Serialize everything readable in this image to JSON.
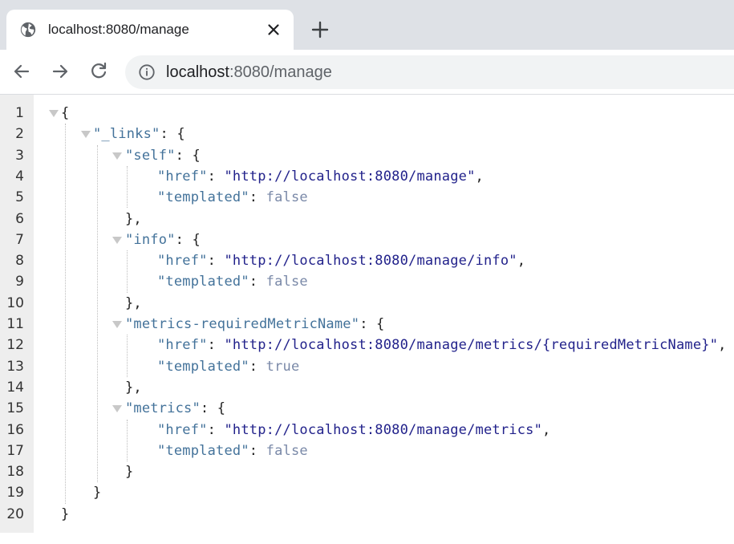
{
  "browser": {
    "tab": {
      "title": "localhost:8080/manage"
    },
    "address": {
      "host": "localhost",
      "rest": ":8080/manage"
    }
  },
  "json_view": {
    "line_numbers": [
      "1",
      "2",
      "3",
      "4",
      "5",
      "6",
      "7",
      "8",
      "9",
      "10",
      "11",
      "12",
      "13",
      "14",
      "15",
      "16",
      "17",
      "18",
      "19",
      "20"
    ],
    "lines": [
      {
        "indent": 0,
        "collapsible": true,
        "parts": [
          [
            "punct",
            "{"
          ]
        ]
      },
      {
        "indent": 1,
        "collapsible": true,
        "parts": [
          [
            "key",
            "\"_links\""
          ],
          [
            "punct",
            ": {"
          ]
        ]
      },
      {
        "indent": 2,
        "collapsible": true,
        "parts": [
          [
            "key",
            "\"self\""
          ],
          [
            "punct",
            ": {"
          ]
        ]
      },
      {
        "indent": 3,
        "collapsible": false,
        "parts": [
          [
            "key",
            "\"href\""
          ],
          [
            "punct",
            ": "
          ],
          [
            "str",
            "\"http://localhost:8080/manage\""
          ],
          [
            "punct",
            ","
          ]
        ]
      },
      {
        "indent": 3,
        "collapsible": false,
        "parts": [
          [
            "key",
            "\"templated\""
          ],
          [
            "punct",
            ": "
          ],
          [
            "bool",
            "false"
          ]
        ]
      },
      {
        "indent": 2,
        "collapsible": false,
        "parts": [
          [
            "punct",
            "},"
          ]
        ]
      },
      {
        "indent": 2,
        "collapsible": true,
        "parts": [
          [
            "key",
            "\"info\""
          ],
          [
            "punct",
            ": {"
          ]
        ]
      },
      {
        "indent": 3,
        "collapsible": false,
        "parts": [
          [
            "key",
            "\"href\""
          ],
          [
            "punct",
            ": "
          ],
          [
            "str",
            "\"http://localhost:8080/manage/info\""
          ],
          [
            "punct",
            ","
          ]
        ]
      },
      {
        "indent": 3,
        "collapsible": false,
        "parts": [
          [
            "key",
            "\"templated\""
          ],
          [
            "punct",
            ": "
          ],
          [
            "bool",
            "false"
          ]
        ]
      },
      {
        "indent": 2,
        "collapsible": false,
        "parts": [
          [
            "punct",
            "},"
          ]
        ]
      },
      {
        "indent": 2,
        "collapsible": true,
        "parts": [
          [
            "key",
            "\"metrics-requiredMetricName\""
          ],
          [
            "punct",
            ": {"
          ]
        ]
      },
      {
        "indent": 3,
        "collapsible": false,
        "parts": [
          [
            "key",
            "\"href\""
          ],
          [
            "punct",
            ": "
          ],
          [
            "str",
            "\"http://localhost:8080/manage/metrics/{requiredMetricName}\""
          ],
          [
            "punct",
            ","
          ]
        ]
      },
      {
        "indent": 3,
        "collapsible": false,
        "parts": [
          [
            "key",
            "\"templated\""
          ],
          [
            "punct",
            ": "
          ],
          [
            "bool",
            "true"
          ]
        ]
      },
      {
        "indent": 2,
        "collapsible": false,
        "parts": [
          [
            "punct",
            "},"
          ]
        ]
      },
      {
        "indent": 2,
        "collapsible": true,
        "parts": [
          [
            "key",
            "\"metrics\""
          ],
          [
            "punct",
            ": {"
          ]
        ]
      },
      {
        "indent": 3,
        "collapsible": false,
        "parts": [
          [
            "key",
            "\"href\""
          ],
          [
            "punct",
            ": "
          ],
          [
            "str",
            "\"http://localhost:8080/manage/metrics\""
          ],
          [
            "punct",
            ","
          ]
        ]
      },
      {
        "indent": 3,
        "collapsible": false,
        "parts": [
          [
            "key",
            "\"templated\""
          ],
          [
            "punct",
            ": "
          ],
          [
            "bool",
            "false"
          ]
        ]
      },
      {
        "indent": 2,
        "collapsible": false,
        "parts": [
          [
            "punct",
            "}"
          ]
        ]
      },
      {
        "indent": 1,
        "collapsible": false,
        "parts": [
          [
            "punct",
            "}"
          ]
        ]
      },
      {
        "indent": 0,
        "collapsible": false,
        "parts": [
          [
            "punct",
            "}"
          ]
        ]
      }
    ]
  },
  "icons": {
    "tab_favicon": "globe-icon",
    "tab_close": "close-icon",
    "new_tab": "plus-icon",
    "back": "arrow-left-icon",
    "forward": "arrow-right-icon",
    "reload": "reload-icon",
    "site_info": "info-icon",
    "toggle": "triangle-down-icon"
  },
  "colors": {
    "key": "#43729a",
    "string": "#22228b",
    "boolean": "#7a89a8",
    "punctuation": "#222222"
  }
}
